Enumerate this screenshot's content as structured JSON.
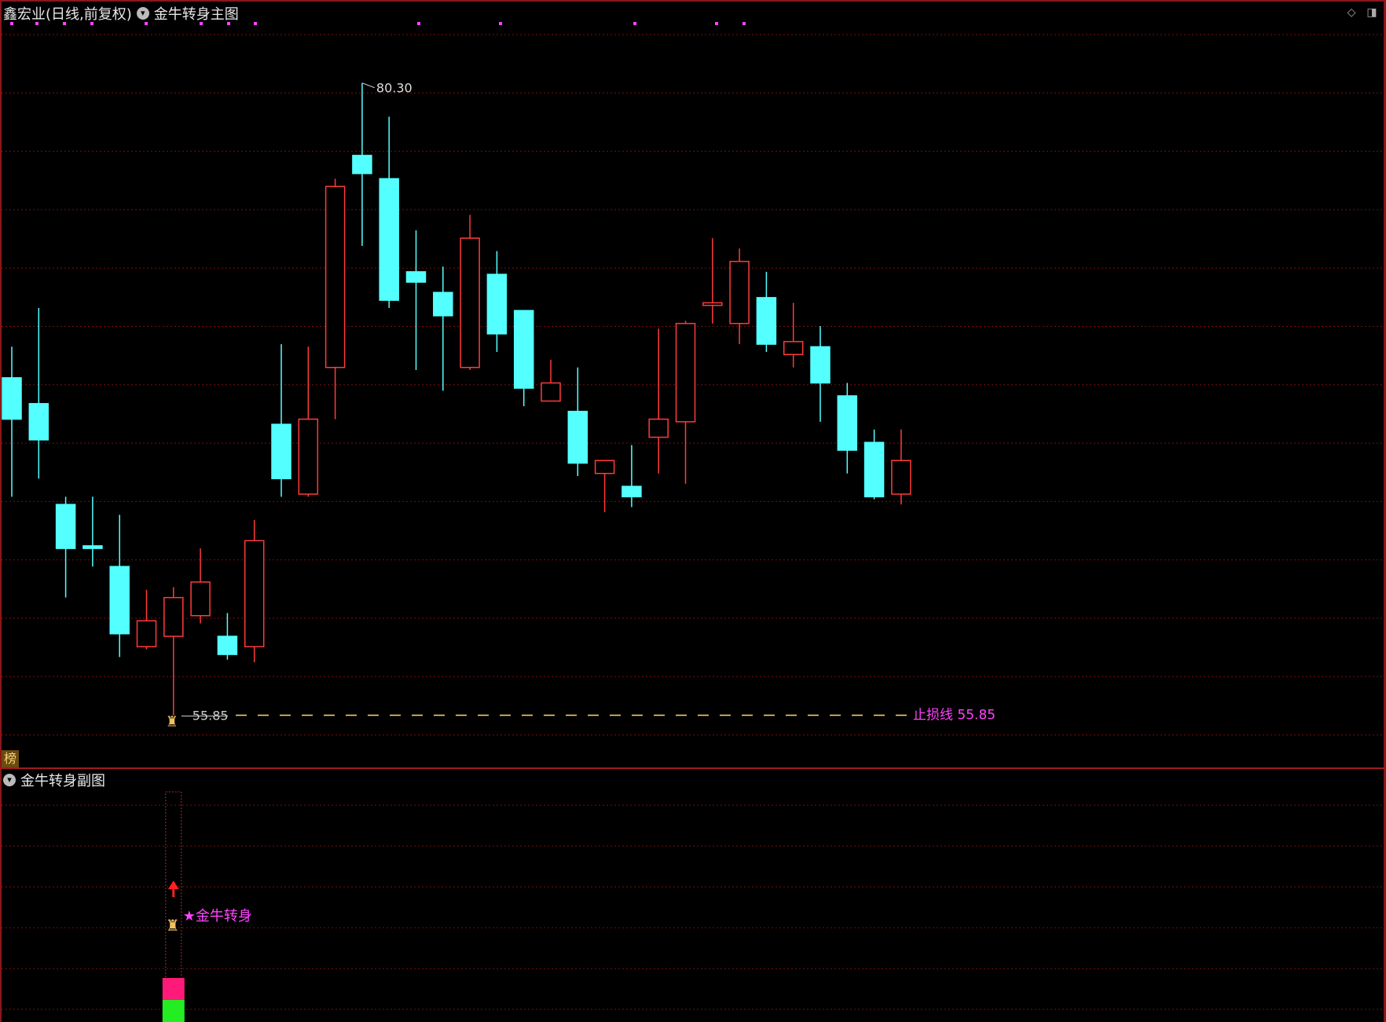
{
  "window": {
    "title_stock": "鑫宏业(日线,前复权)",
    "title_indicator": "金牛转身主图",
    "sub_indicator": "金牛转身副图",
    "bang_label": "榜",
    "controls": [
      "diamond-icon",
      "panel-toggle-icon"
    ]
  },
  "colors": {
    "background": "#000000",
    "up": "#ff3b3b",
    "down": "#54ffff",
    "grid": "#7a1010",
    "stoploss": "#ffd966",
    "signal": "#ff44ff"
  },
  "annotations": {
    "high_label": "80.30",
    "low_label": "55.85",
    "stoploss_label": "止损线 55.85",
    "signal_label": "★金牛转身"
  },
  "chart_data": {
    "type": "candlestick",
    "price_range": [
      54.8,
      82.6
    ],
    "candles": [
      {
        "o": 68.9,
        "h": 70.1,
        "l": 64.3,
        "c": 67.3
      },
      {
        "o": 67.9,
        "h": 71.6,
        "l": 65.0,
        "c": 66.5
      },
      {
        "o": 64.0,
        "h": 64.3,
        "l": 60.4,
        "c": 62.3
      },
      {
        "o": 62.4,
        "h": 64.3,
        "l": 61.6,
        "c": 62.3
      },
      {
        "o": 61.6,
        "h": 63.6,
        "l": 58.1,
        "c": 59.0
      },
      {
        "o": 58.5,
        "h": 60.7,
        "l": 58.4,
        "c": 59.5
      },
      {
        "o": 58.9,
        "h": 60.8,
        "l": 55.85,
        "c": 60.4
      },
      {
        "o": 59.7,
        "h": 62.3,
        "l": 59.4,
        "c": 61.0
      },
      {
        "o": 58.9,
        "h": 59.8,
        "l": 58.0,
        "c": 58.2
      },
      {
        "o": 58.5,
        "h": 63.4,
        "l": 57.9,
        "c": 62.6
      },
      {
        "o": 67.1,
        "h": 70.2,
        "l": 64.3,
        "c": 65.0
      },
      {
        "o": 64.4,
        "h": 70.1,
        "l": 64.3,
        "c": 67.3
      },
      {
        "o": 69.3,
        "h": 76.6,
        "l": 67.3,
        "c": 76.3
      },
      {
        "o": 77.5,
        "h": 80.3,
        "l": 74.0,
        "c": 76.8
      },
      {
        "o": 76.6,
        "h": 79.0,
        "l": 71.6,
        "c": 71.9
      },
      {
        "o": 73.0,
        "h": 74.6,
        "l": 69.2,
        "c": 72.6
      },
      {
        "o": 72.2,
        "h": 73.2,
        "l": 68.4,
        "c": 71.3
      },
      {
        "o": 69.3,
        "h": 75.2,
        "l": 69.2,
        "c": 74.3
      },
      {
        "o": 72.9,
        "h": 73.8,
        "l": 69.9,
        "c": 70.6
      },
      {
        "o": 71.5,
        "h": 71.5,
        "l": 67.8,
        "c": 68.5
      },
      {
        "o": 68.0,
        "h": 69.6,
        "l": 68.0,
        "c": 68.7
      },
      {
        "o": 67.6,
        "h": 69.3,
        "l": 65.1,
        "c": 65.6
      },
      {
        "o": 65.2,
        "h": 65.4,
        "l": 63.7,
        "c": 65.7
      },
      {
        "o": 64.7,
        "h": 66.3,
        "l": 63.9,
        "c": 64.3
      },
      {
        "o": 66.6,
        "h": 70.8,
        "l": 65.2,
        "c": 67.3
      },
      {
        "o": 67.2,
        "h": 71.1,
        "l": 64.8,
        "c": 71.0
      },
      {
        "o": 71.7,
        "h": 74.3,
        "l": 71.0,
        "c": 71.8
      },
      {
        "o": 71.0,
        "h": 73.9,
        "l": 70.2,
        "c": 73.4
      },
      {
        "o": 72.0,
        "h": 73.0,
        "l": 69.9,
        "c": 70.2
      },
      {
        "o": 69.8,
        "h": 71.8,
        "l": 69.3,
        "c": 70.3
      },
      {
        "o": 70.1,
        "h": 70.9,
        "l": 67.2,
        "c": 68.7
      },
      {
        "o": 68.2,
        "h": 68.7,
        "l": 65.2,
        "c": 66.1
      },
      {
        "o": 66.4,
        "h": 66.9,
        "l": 64.2,
        "c": 64.3
      },
      {
        "o": 64.4,
        "h": 66.9,
        "l": 64.0,
        "c": 65.7
      }
    ],
    "stoploss": 55.85,
    "signal_index": 6
  }
}
